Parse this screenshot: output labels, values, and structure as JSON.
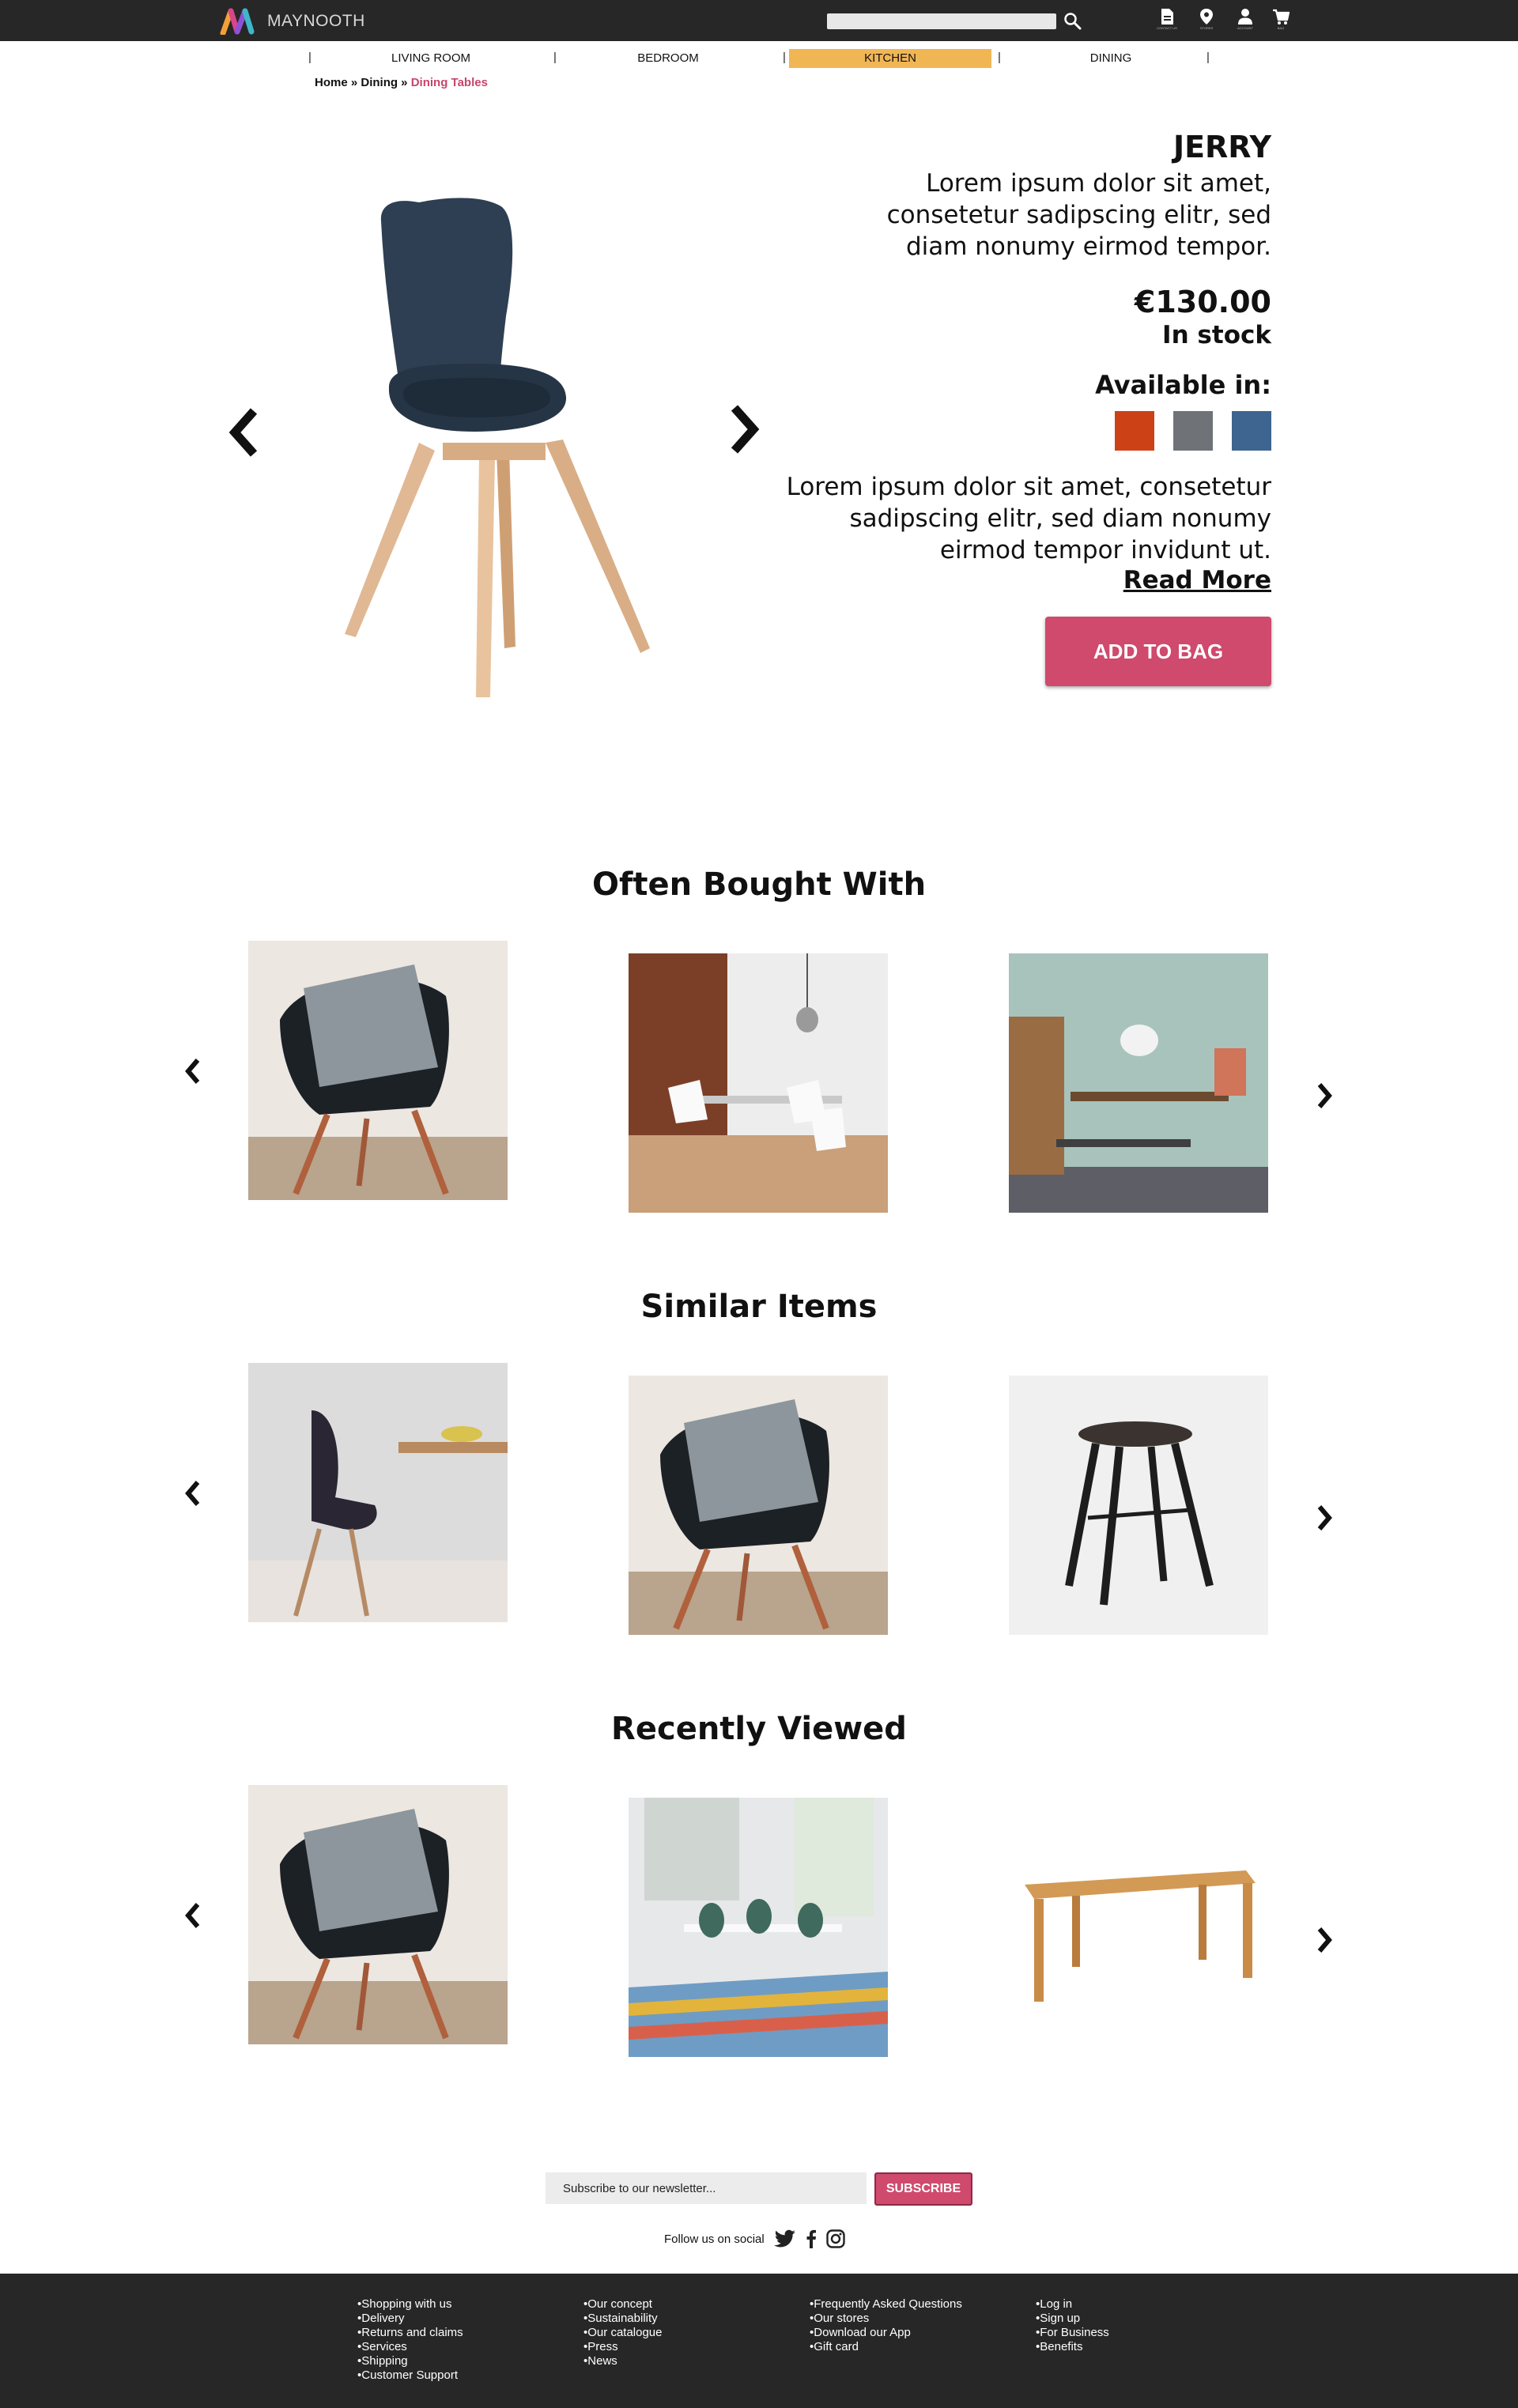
{
  "header": {
    "brand": "MAYNOOTH",
    "search_placeholder": "",
    "icons": [
      {
        "name": "account-icon",
        "caption": "CONTACT US"
      },
      {
        "name": "location-pin-icon",
        "caption": "STORES"
      },
      {
        "name": "user-icon",
        "caption": "ACCOUNT"
      },
      {
        "name": "cart-icon",
        "caption": "BAG"
      }
    ]
  },
  "nav": {
    "items": [
      "LIVING ROOM",
      "BEDROOM",
      "KITCHEN",
      "DINING"
    ],
    "separator": "|",
    "active": "KITCHEN",
    "active_color": "#f1b654"
  },
  "breadcrumb": {
    "home": "Home »",
    "dining": "Dining »",
    "current": "Dining Tables"
  },
  "product": {
    "name": "JERRY",
    "description": "Lorem ipsum dolor sit amet, consetetur sadipscing elitr, sed diam nonumy eirmod tempor.",
    "price": "€130.00",
    "stock": "In stock",
    "available_label": "Available in:",
    "colors": [
      "#cc4216",
      "#6f7378",
      "#3d6590"
    ],
    "long_description": "Lorem ipsum dolor sit amet, consetetur sadipscing elitr, sed diam nonumy eirmod tempor invidunt ut.",
    "read_more": "Read More",
    "add_to_bag": "ADD TO BAG"
  },
  "sections": {
    "often_bought": "Often Bought With",
    "similar": "Similar Items",
    "recent": "Recently Viewed"
  },
  "newsletter": {
    "placeholder": "Subscribe to our newsletter...",
    "button": "SUBSCRIBE",
    "follow": "Follow us on social"
  },
  "footer": {
    "col1": [
      "Shopping with us",
      "Delivery",
      "Returns and claims",
      "Services",
      "Shipping",
      "Customer Support"
    ],
    "col2": [
      "Our concept",
      "Sustainability",
      "Our catalogue",
      "Press",
      "News"
    ],
    "col3": [
      "Frequently Asked Questions",
      "Our stores",
      "Download our App",
      "Gift card"
    ],
    "col4": [
      "Log in",
      "Sign up",
      "For Business",
      "Benefits"
    ]
  },
  "colors": {
    "header_bg": "#272727",
    "accent_pink": "#cf4a6d",
    "breadcrumb_current": "#c8456b"
  }
}
